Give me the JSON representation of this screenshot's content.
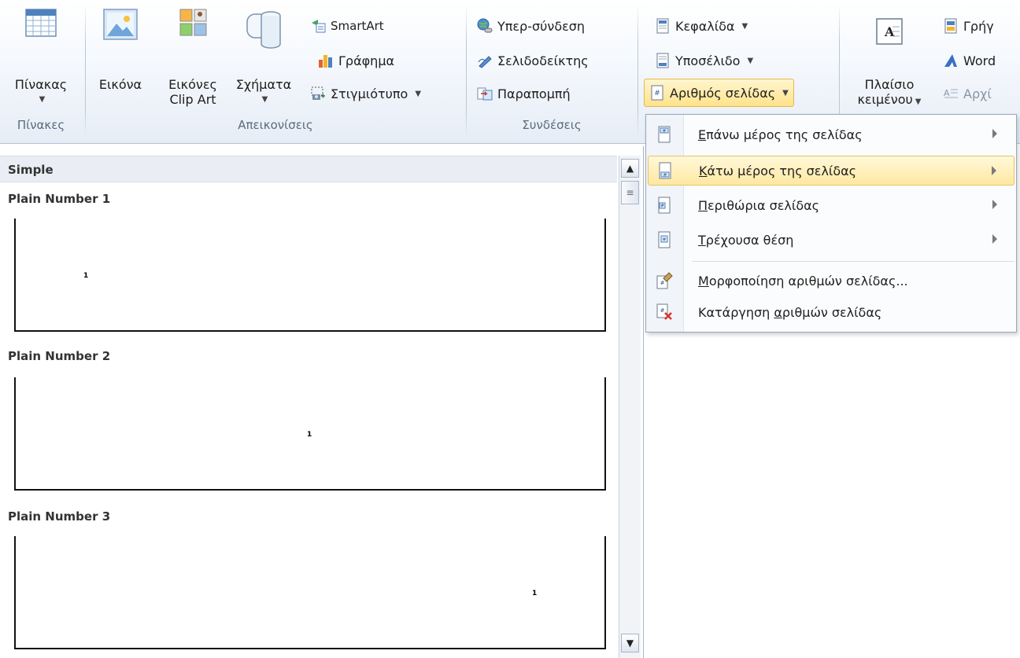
{
  "ribbon": {
    "groups": {
      "tables": {
        "label": "Πίνακες",
        "table_button": "Πίνακας"
      },
      "illustrations": {
        "label": "Απεικονίσεις",
        "picture": "Εικόνα",
        "clipart_line1": "Εικόνες",
        "clipart_line2": "Clip Art",
        "shapes": "Σχήματα",
        "smartart": "SmartArt",
        "chart": "Γράφημα",
        "screenshot": "Στιγμιότυπο"
      },
      "links": {
        "label": "Συνδέσεις",
        "hyperlink": "Υπερ-σύνδεση",
        "bookmark": "Σελιδοδείκτης",
        "crossref": "Παραπομπή"
      },
      "header_footer": {
        "header": "Κεφαλίδα",
        "footer": "Υποσέλιδο",
        "page_number": "Αριθμός σελίδας"
      },
      "text": {
        "textbox_line1": "Πλαίσιο",
        "textbox_line2": "κειμένου",
        "quickparts": "Γρήγ",
        "wordart": "Word",
        "dropcap": "Αρχί"
      }
    }
  },
  "gallery": {
    "section": "Simple",
    "items": [
      {
        "title": "Plain Number 1",
        "number": "1",
        "align": "left"
      },
      {
        "title": "Plain Number 2",
        "number": "1",
        "align": "center"
      },
      {
        "title": "Plain Number 3",
        "number": "1",
        "align": "right"
      }
    ]
  },
  "menu": {
    "items": [
      {
        "pre": "",
        "ul": "Ε",
        "post": "πάνω μέρος της σελίδας",
        "submenu": true
      },
      {
        "pre": "",
        "ul": "Κ",
        "post": "άτω μέρος της σελίδας",
        "submenu": true
      },
      {
        "pre": "",
        "ul": "Π",
        "post": "εριθώρια σελίδας",
        "submenu": true
      },
      {
        "pre": "",
        "ul": "Τ",
        "post": "ρέχουσα θέση",
        "submenu": true
      },
      {
        "pre": "",
        "ul": "Μ",
        "post": "ορφοποίηση αριθμών σελίδας...",
        "submenu": false
      },
      {
        "pre": "Κατάργηση ",
        "ul": "α",
        "post": "ριθμών σελίδας",
        "submenu": false
      }
    ]
  },
  "colors": {
    "accent_hover": "#ffe8a0",
    "ribbon_bg": "#e6edf6"
  }
}
